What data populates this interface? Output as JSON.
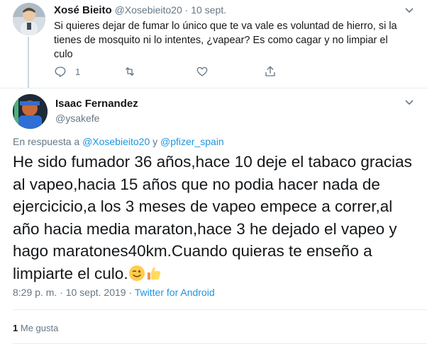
{
  "tweet1": {
    "name": "Xosé Bieito",
    "handle": "@Xosebieito20",
    "separator": "·",
    "date": "10 sept.",
    "text": "Si quieres dejar de fumar lo único que te va vale es voluntad de hierro, si la tienes de mosquito ni lo intentes, ¿vapear? Es como cagar y  no limpiar el culo",
    "actions": {
      "reply_count": "1",
      "retweet_count": "",
      "like_count": ""
    }
  },
  "tweet2": {
    "name": "Isaac Fernandez",
    "handle": "@ysakefe",
    "reply_prefix": "En respuesta a",
    "reply_user1": "@Xosebieito20",
    "reply_and": "y",
    "reply_user2": "@pfizer_spain",
    "text": "He sido fumador 36 años,hace 10 deje el tabaco gracias al vapeo,hacia 15 años que no podia hacer nada de ejercicicio,a los 3 meses de vapeo empece a correr,al año hacia media maraton,hace 3 he dejado el vapeo y hago maratones40km.Cuando quieras te enseño a limpiarte el culo.",
    "emojis": [
      "winking-face-emoji",
      "thumbs-up-emoji"
    ],
    "time": "8:29 p. m.",
    "date_sep": "·",
    "date": "10 sept. 2019",
    "source_sep": "·",
    "source": "Twitter for Android",
    "likes_count": "1",
    "likes_label": "Me gusta"
  },
  "colors": {
    "accent": "#1b95e0",
    "muted": "#657786",
    "text": "#14171a",
    "border": "#e6ecf0"
  }
}
